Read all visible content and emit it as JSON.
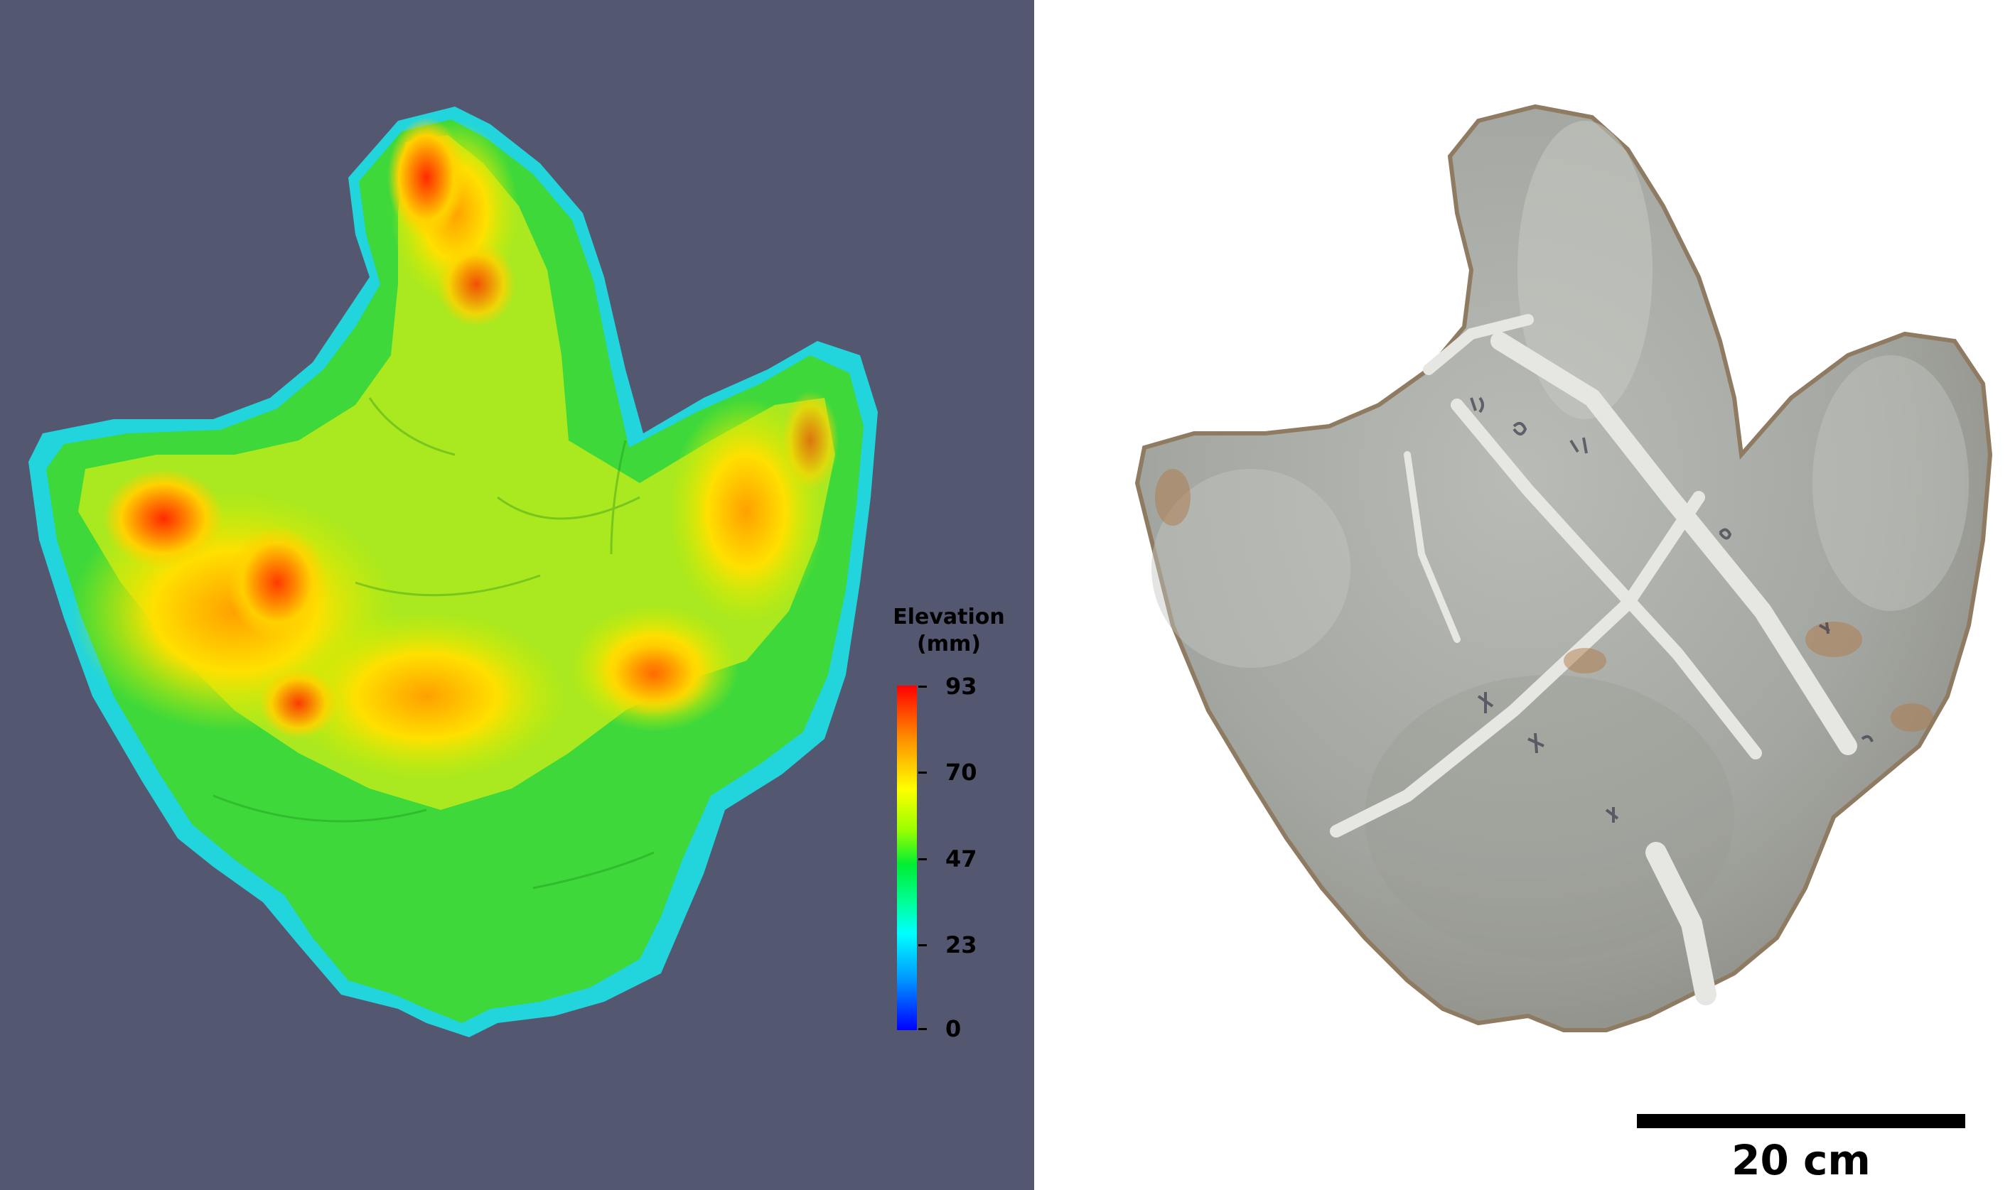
{
  "legend": {
    "title_line1": "Elevation",
    "title_line2": "(mm)",
    "ticks": [
      "93",
      "70",
      "47",
      "23",
      "0"
    ]
  },
  "scale": {
    "label": "20 cm"
  },
  "figure": {
    "left_panel_bg": "#535770",
    "right_panel_bg": "#ffffff",
    "left_subject": "color-mapped elevation model of a tridactyl footprint cast",
    "right_subject": "photograph of the fossil footprint cast"
  }
}
